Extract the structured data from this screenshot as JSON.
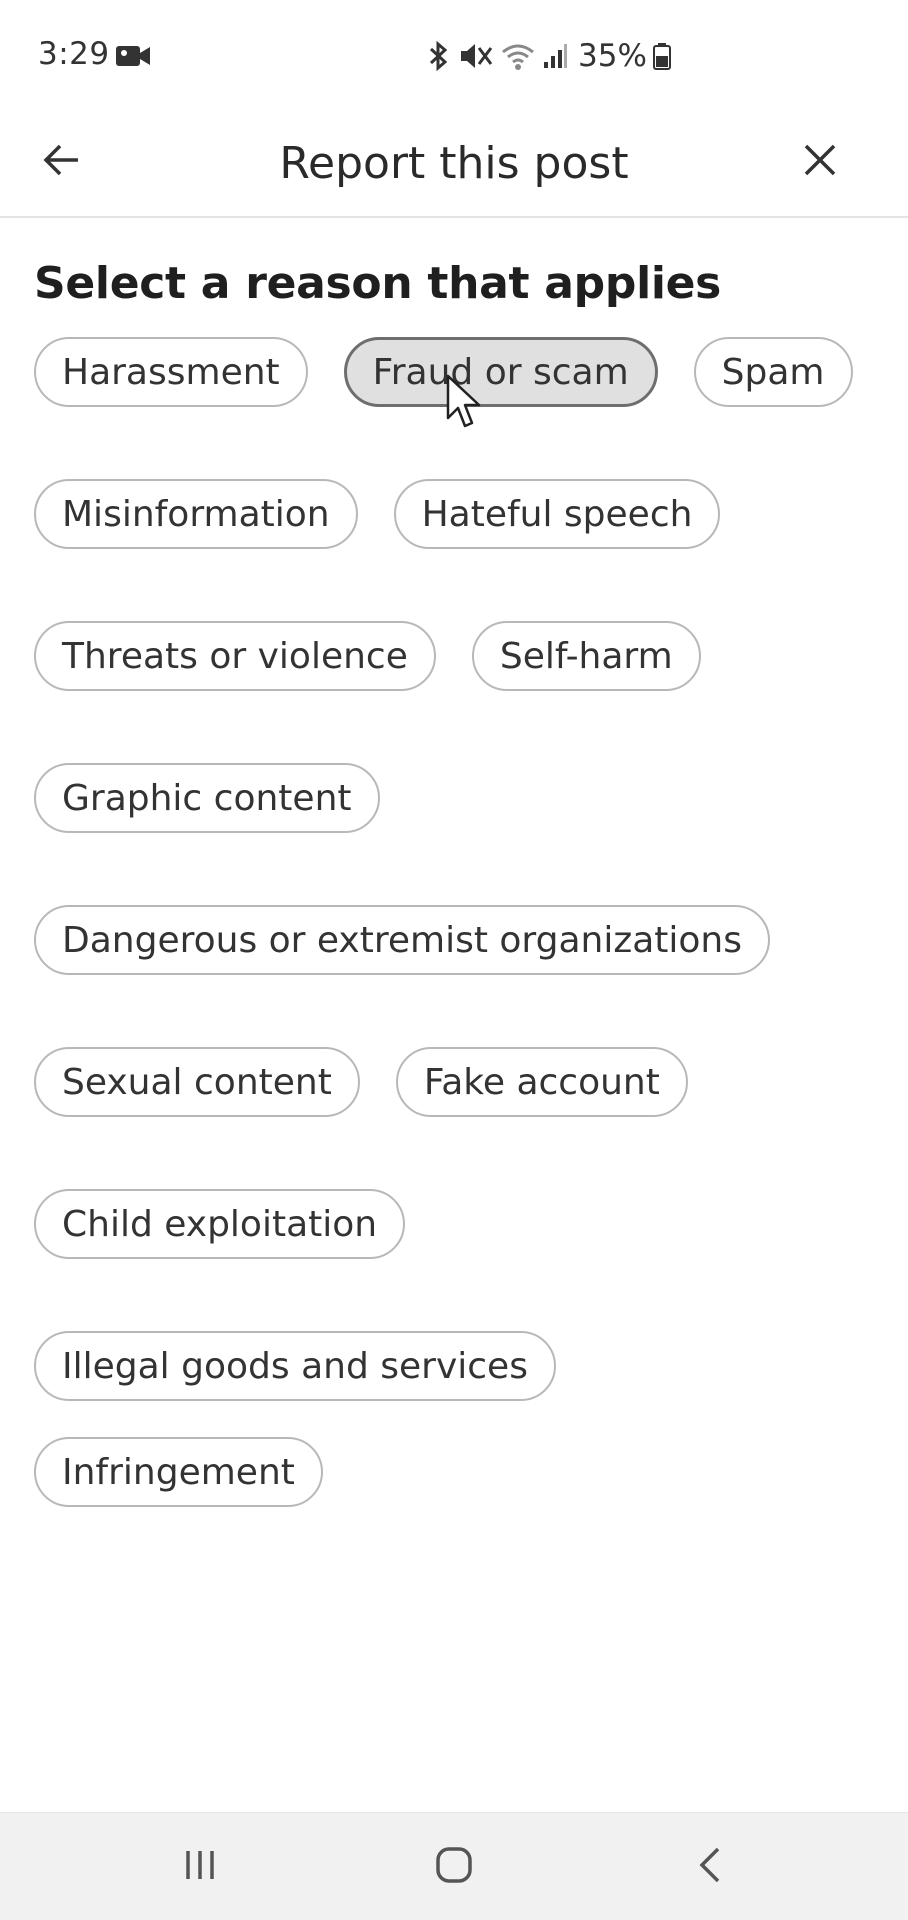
{
  "status_bar": {
    "time": "3:29",
    "battery": "35%",
    "icons": [
      "video-icon",
      "bluetooth-icon",
      "mute-icon",
      "wifi-icon",
      "signal-icon",
      "battery-icon"
    ]
  },
  "header": {
    "title": "Report this post",
    "back_icon": "arrow-left-icon",
    "close_icon": "close-icon"
  },
  "main": {
    "heading": "Select a reason that applies",
    "reasons": [
      {
        "label": "Harassment",
        "selected": false
      },
      {
        "label": "Fraud or scam",
        "selected": true
      },
      {
        "label": "Spam",
        "selected": false
      },
      {
        "label": "Misinformation",
        "selected": false
      },
      {
        "label": "Hateful speech",
        "selected": false
      },
      {
        "label": "Threats or violence",
        "selected": false
      },
      {
        "label": "Self-harm",
        "selected": false
      },
      {
        "label": "Graphic content",
        "selected": false
      },
      {
        "label": "Dangerous or extremist organizations",
        "selected": false
      },
      {
        "label": "Sexual content",
        "selected": false
      },
      {
        "label": "Fake account",
        "selected": false
      },
      {
        "label": "Child exploitation",
        "selected": false
      },
      {
        "label": "Illegal goods and services",
        "selected": false
      },
      {
        "label": "Infringement",
        "selected": false
      }
    ]
  },
  "nav_bar": {
    "icons": [
      "recent-apps-icon",
      "home-icon",
      "back-icon"
    ]
  },
  "colors": {
    "chip_border": "#b8b8b8",
    "chip_selected_bg": "#e0e0e0",
    "chip_selected_border": "#6e6e6e",
    "nav_bar_bg": "#f1f1f1"
  }
}
